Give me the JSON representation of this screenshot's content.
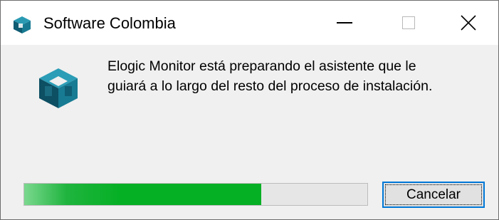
{
  "window": {
    "title": "Software Colombia",
    "title_icon": "app-cube-icon",
    "buttons": {
      "minimize": "minimize-icon",
      "maximize": "maximize-icon",
      "close": "close-icon"
    }
  },
  "content": {
    "icon": "app-cube-icon",
    "message_line1": "Elogic Monitor está preparando el asistente que le",
    "message_line2": "guiará a lo largo del resto del proceso de instalación."
  },
  "progress": {
    "value": 0.69,
    "color": "#06b025"
  },
  "cancel_button": {
    "label": "Cancelar",
    "focus_color": "#0078d7"
  },
  "colors": {
    "icon_teal": "#1a8fa6",
    "icon_dark": "#0d4f63"
  }
}
